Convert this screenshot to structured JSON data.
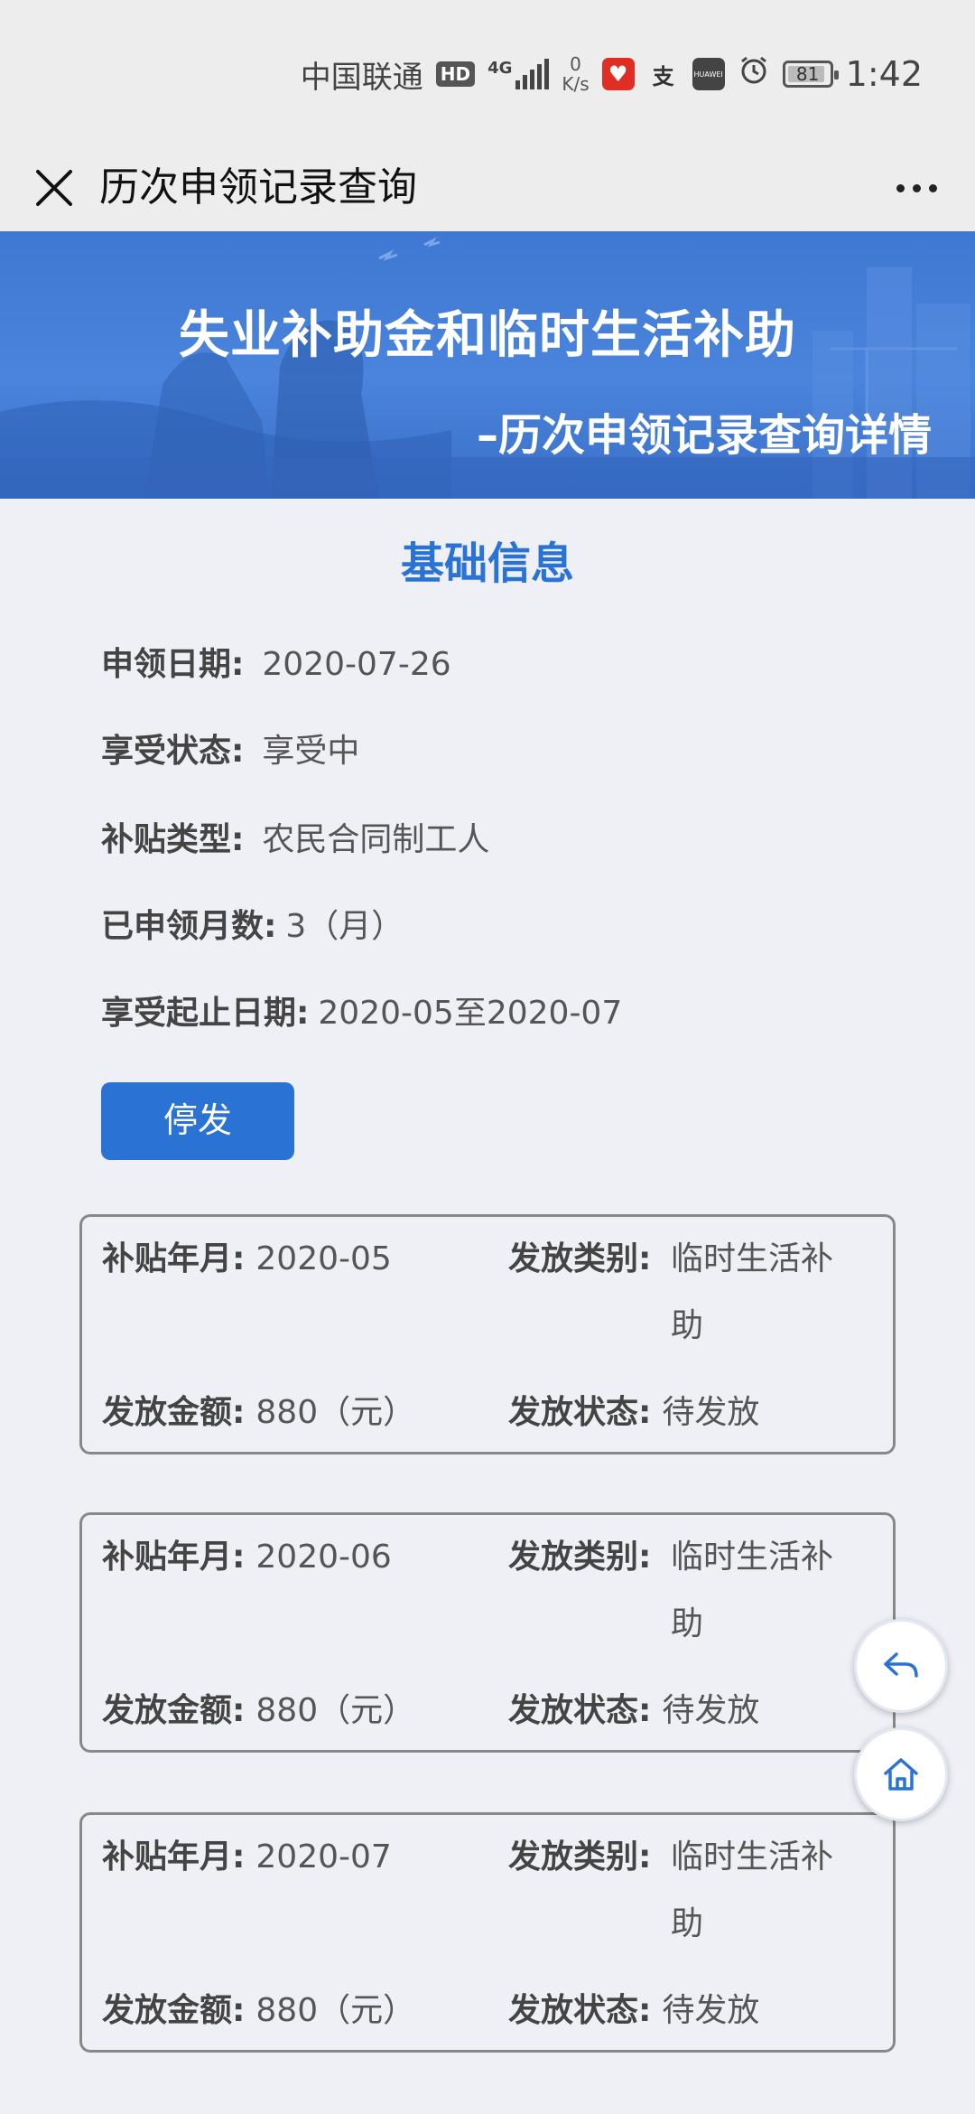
{
  "status_bar": {
    "carrier": "中国联通",
    "hd": "HD",
    "network": "4G",
    "speed_value": "0",
    "speed_unit": "K/s",
    "battery": "81",
    "time": "1:42",
    "app_icons": [
      "pinduoduo-icon",
      "alipay-icon",
      "huawei-icon"
    ],
    "alipay_glyph": "支",
    "huawei_label": "HUAWEI"
  },
  "title_bar": {
    "title": "历次申领记录查询"
  },
  "banner": {
    "title": "失业补助金和临时生活补助",
    "subtitle": "–历次申领记录查询详情"
  },
  "section": {
    "title": "基础信息"
  },
  "info": {
    "apply_date_label": "申领日期:",
    "apply_date": "2020-07-26",
    "status_label": "享受状态:",
    "status": "享受中",
    "subsidy_type_label": "补贴类型:",
    "subsidy_type": "农民合同制工人",
    "months_label": "已申领月数:",
    "months": "3（月）",
    "period_label": "享受起止日期:",
    "period": "2020-05至2020-07"
  },
  "stop_button": "停发",
  "card_labels": {
    "month": "补贴年月:",
    "type": "发放类别:",
    "amount": "发放金额:",
    "status": "发放状态:"
  },
  "records": [
    {
      "month": "2020-05",
      "type": "临时生活补助",
      "amount": "880（元）",
      "status": "待发放"
    },
    {
      "month": "2020-06",
      "type": "临时生活补助",
      "amount": "880（元）",
      "status": "待发放"
    },
    {
      "month": "2020-07",
      "type": "临时生活补助",
      "amount": "880（元）",
      "status": "待发放"
    }
  ],
  "colors": {
    "accent": "#2a73d4",
    "banner": "#4a84dc",
    "page_bg": "#eef0f5"
  }
}
